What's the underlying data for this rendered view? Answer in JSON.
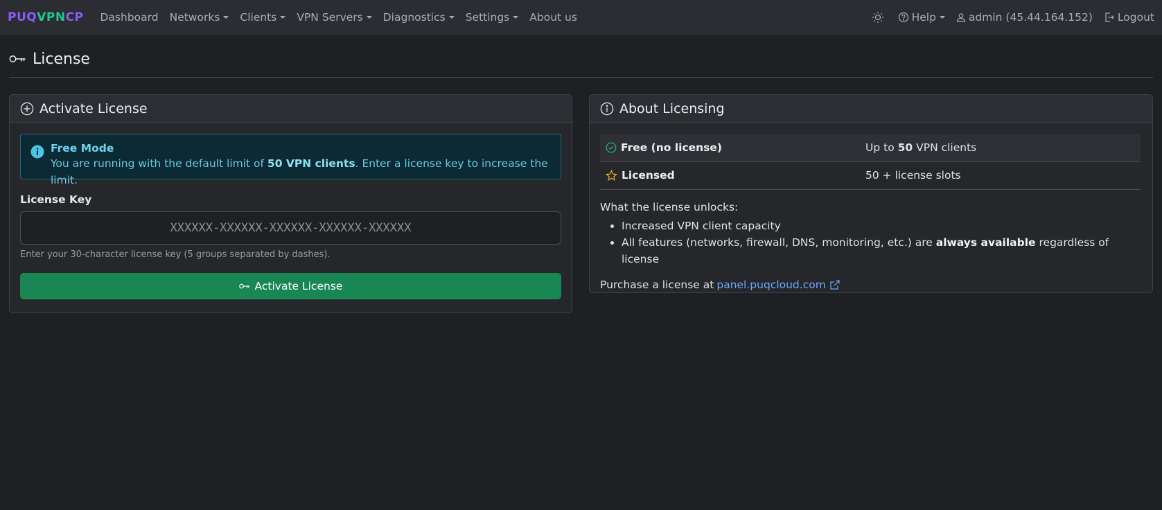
{
  "brand": {
    "part1": "PUQ",
    "part2": "VPN",
    "part3": "CP"
  },
  "nav": {
    "dashboard": "Dashboard",
    "networks": "Networks",
    "clients": "Clients",
    "vpn_servers": "VPN Servers",
    "diagnostics": "Diagnostics",
    "settings": "Settings",
    "about": "About us",
    "help": "Help",
    "user": "admin (45.44.164.152)",
    "logout": "Logout"
  },
  "page": {
    "title": "License"
  },
  "activate": {
    "header": "Activate License",
    "alert_title": "Free Mode",
    "alert_text_pre": "You are running with the default limit of ",
    "alert_text_bold": "50 VPN clients",
    "alert_text_post": ". Enter a license key to increase the limit.",
    "key_label": "License Key",
    "key_placeholder": "XXXXXX-XXXXXX-XXXXXX-XXXXXX-XXXXXX",
    "key_help": "Enter your 30-character license key (5 groups separated by dashes).",
    "button": "Activate License"
  },
  "about": {
    "header": "About Licensing",
    "rows": [
      {
        "name": "Free (no license)",
        "value_pre": "Up to ",
        "value_bold": "50",
        "value_post": " VPN clients"
      },
      {
        "name": "Licensed",
        "value_pre": "50 + license slots",
        "value_bold": "",
        "value_post": ""
      }
    ],
    "unlocks_title": "What the license unlocks:",
    "unlock_1": "Increased VPN client capacity",
    "unlock_2_pre": "All features (networks, firewall, DNS, monitoring, etc.) are ",
    "unlock_2_bold": "always available",
    "unlock_2_post": " regardless of license",
    "purchase_text": "Purchase a license at",
    "purchase_link": "panel.puqcloud.com"
  },
  "colors": {
    "accent_green": "#198754",
    "info": "#6cc9e0",
    "link": "#6ea8fe",
    "brand_purple": "#8b5cf6",
    "brand_green": "#22c58b"
  }
}
